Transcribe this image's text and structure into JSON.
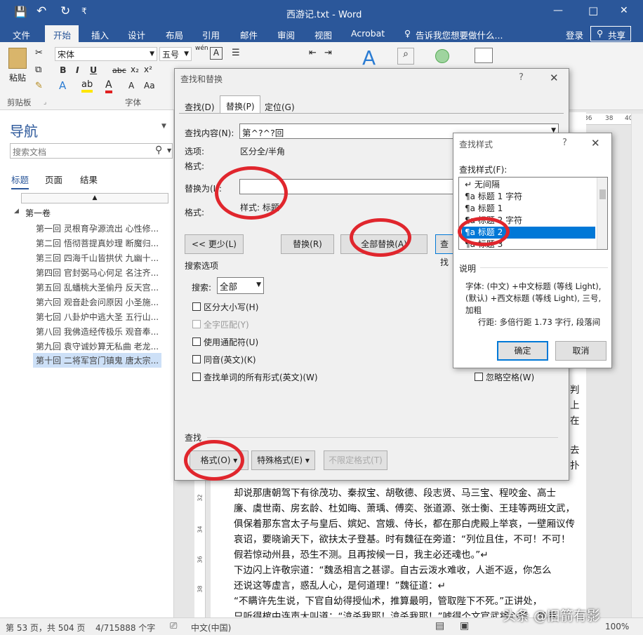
{
  "window": {
    "title": "西游记.txt - Word",
    "min": "—",
    "max": "□",
    "close": "✕"
  },
  "quick": {
    "save": "💾",
    "undo": "↶",
    "redo": "↻",
    "more": "₹"
  },
  "tabs": [
    "文件",
    "开始",
    "插入",
    "设计",
    "布局",
    "引用",
    "邮件",
    "审阅",
    "视图",
    "Acrobat"
  ],
  "tellme": "告诉我您想要做什么...",
  "login": "登录",
  "share": "共享",
  "ribbon": {
    "font": "宋体",
    "size": "五号",
    "wen": "wén",
    "A": "A",
    "paste": "粘贴",
    "clipboard": "剪贴板",
    "fontgroup": "字体",
    "b": "B",
    "i": "I",
    "u": "U",
    "abc": "abc",
    "x2": "x₂",
    "x2s": "x²"
  },
  "nav": {
    "title": "导航",
    "search_ph": "搜索文档",
    "tabs": [
      "标题",
      "页面",
      "结果"
    ],
    "root": "第一卷",
    "items": [
      "第一回 灵根育孕源流出 心性修...",
      "第二回 悟彻菩提真妙理 断魔归...",
      "第三回 四海千山皆拱伏 九幽十...",
      "第四回 官封弼马心何足 名注齐...",
      "第五回 乱蟠桃大圣偷丹 反天宫...",
      "第六回 观音赴会问原因 小圣施...",
      "第七回 八卦炉中逃大圣 五行山...",
      "第八回 我佛造经传极乐 观音奉...",
      "第九回 袁守诚妙算无私曲 老龙...",
      "第十回 二将军宫门镇鬼 唐太宗..."
    ]
  },
  "ruler": [
    "36",
    "38",
    "40"
  ],
  "vruler": [
    "32",
    "34",
    "36",
    "38"
  ],
  "doc": {
    "right": [
      "判",
      "上",
      "在",
      "去",
      "扑"
    ],
    "lines": [
      "却说那唐朝驾下有徐茂功、秦叔宝、胡敬德、段志贤、马三宝、程咬金、高士",
      "廉、虞世南、房玄龄、杜如晦、萧瑀、傅奕、张道源、张士衡、王珪等两班文武，",
      "俱保着那东宫太子与皇后、嫔妃、宫娥、侍长，都在那白虎殿上举哀，一壁厢议传",
      "哀诏，要晓谕天下，欲扶太子登基。时有魏征在旁道：“列位且住，不可！不可！",
      "假若惊动州县，恐生不测。且再按候一日，我主必还魂也。”↵",
      "    下边闪上许敬宗道：“魏丞相言之甚谬。自古云泼水难收，人逝不返，你怎么",
      "还说这等虚言，惑乱人心，是何道理！”魏征道：↵",
      "    “不瞒许先生说，下官自幼得授仙术，推算最明，管取陛下不死。”正讲处，",
      "只听得棺中连声大叫道：“渰杀我耶！渰杀我耶！”唬得个文官武将心慌，皇后"
    ]
  },
  "status": {
    "page": "第 53 页，共 504 页",
    "words": "4/715888 个字",
    "lang": "中文(中国)",
    "zoom": "100%",
    "watermark": "头条 @旧箭有影"
  },
  "dialog": {
    "title": "查找和替换",
    "help": "?",
    "close": "✕",
    "tabs": [
      "查找(D)",
      "替换(P)",
      "定位(G)"
    ],
    "find_label": "查找内容(N):",
    "find_value": "第^?^?回",
    "options_label": "选项:",
    "options_value": "区分全/半角",
    "format_label": "格式:",
    "replace_label": "替换为(I):",
    "replace_value": "",
    "replace_format_label": "格式:",
    "replace_format_value": "样式: 标题",
    "less": "<< 更少(L)",
    "replace": "替换(R)",
    "replace_all": "全部替换(A)",
    "find_next": "查找",
    "search_options": "搜索选项",
    "search_label": "搜索:",
    "search_value": "全部",
    "checks": [
      "区分大小写(H)",
      "全字匹配(Y)",
      "使用通配符(U)",
      "同音(英文)(K)",
      "查找单词的所有形式(英文)(W)"
    ],
    "ignore_space": "忽略空格(W)",
    "find_section": "查找",
    "format_btn": "格式(O) ▾",
    "special_btn": "特殊格式(E) ▾",
    "noformat_btn": "不限定格式(T)"
  },
  "style_dialog": {
    "title": "查找样式",
    "help": "?",
    "close": "✕",
    "label": "查找样式(F):",
    "items": [
      "↵ 无间隔",
      "¶a 标题 1 字符",
      "¶a 标题 1",
      "¶a 标题 2 字符",
      "¶a 标题 2",
      "¶a 标题 3"
    ],
    "desc_label": "说明",
    "desc1": "字体: (中文) +中文标题 (等线 Light),",
    "desc2": "(默认) +西文标题 (等线 Light), 三号,",
    "desc3": "加粗",
    "desc4": "行距: 多倍行距 1.73 字行, 段落间",
    "ok": "确定",
    "cancel": "取消"
  },
  "colors": {
    "word_blue": "#2b579a",
    "highlight": "#cde0f7",
    "selection": "#0078d7",
    "ring": "#e0262d"
  }
}
